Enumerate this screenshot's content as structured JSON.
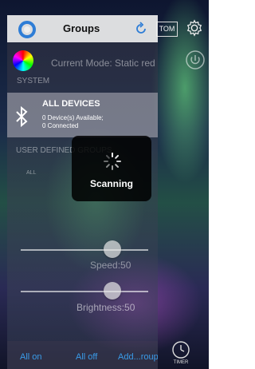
{
  "background": {
    "custom_label": "TOM",
    "timer_label": "TIMER"
  },
  "drawer": {
    "title": "Groups",
    "system": {
      "current_mode": "Current Mode: Static red",
      "label": "SYSTEM"
    },
    "all_devices": {
      "title": "ALL DEVICES",
      "available": "0 Device(s) Available;",
      "connected": "0 Connected"
    },
    "user_defined_label": "USER DEFINED GROUPS",
    "small_label": "ALL",
    "speed": {
      "label": "Speed:50",
      "value": 50
    },
    "brightness": {
      "label": "Brightness:50",
      "value": 50
    },
    "footer": {
      "all_on": "All on",
      "all_off": "All off",
      "add_group": "Add...roup"
    }
  },
  "hud": {
    "text": "Scanning"
  },
  "colors": {
    "accent": "#3a9be8",
    "logo": "#2e7dd6"
  }
}
